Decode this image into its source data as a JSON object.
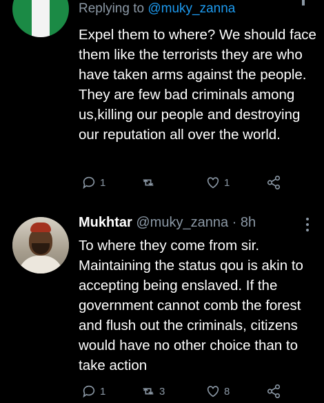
{
  "tweet1": {
    "avatar_icon": "nigeria-flag-avatar",
    "reply_prefix": "Replying to",
    "reply_handle": "@muky_zanna",
    "body": "Expel them to where? We should face them like the terrorists they are who have taken arms against the people. They are few bad criminals among us,killing our people and destroying our reputation all over the world.",
    "actions": {
      "reply_count": "1",
      "retweet_count": "",
      "like_count": "1"
    }
  },
  "tweet2": {
    "name": "Mukhtar",
    "handle_time": "@muky_zanna · 8h",
    "body": "To where they come from sir. Maintaining the status qou is akin to accepting being enslaved. If the government cannot comb the forest and flush out the criminals, citizens would have no other choice than to take action",
    "actions": {
      "reply_count": "1",
      "retweet_count": "3",
      "like_count": "8"
    }
  },
  "colors": {
    "background": "#000000",
    "text": "#ffffff",
    "secondary": "#8b98a5",
    "link": "#1d9bf0"
  },
  "icons": [
    "reply-icon",
    "retweet-icon",
    "like-icon",
    "share-icon",
    "more-icon"
  ]
}
